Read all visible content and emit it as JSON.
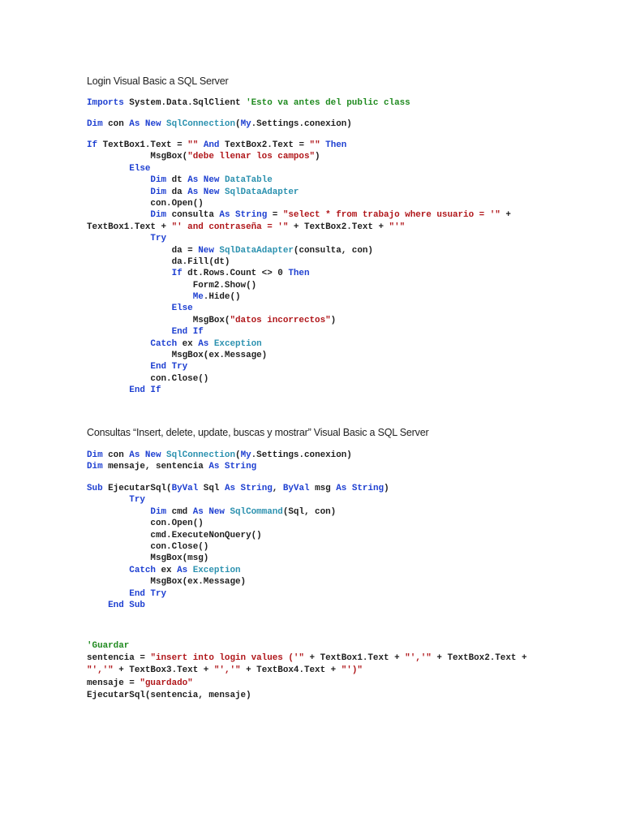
{
  "colors": {
    "keyword": "#1d3fd1",
    "type": "#2b91af",
    "string": "#b0161a",
    "comment": "#1f8a1f",
    "text": "#1e1e1e"
  },
  "title1": "Login Visual Basic a SQL Server",
  "title2": "Consultas “Insert, delete, update, buscas y mostrar” Visual Basic a SQL Server",
  "blocks": {
    "b1": [
      [
        [
          "k",
          "Imports"
        ],
        [
          "p",
          " System.Data.SqlClient "
        ],
        [
          "c",
          "'Esto va antes del public class"
        ]
      ]
    ],
    "b2": [
      [
        [
          "k",
          "Dim"
        ],
        [
          "p",
          " con "
        ],
        [
          "k",
          "As New "
        ],
        [
          "t",
          "SqlConnection"
        ],
        [
          "p",
          "("
        ],
        [
          "k",
          "My"
        ],
        [
          "p",
          ".Settings.conexion)"
        ]
      ]
    ],
    "b3": [
      [
        [
          "k",
          "If"
        ],
        [
          "p",
          " TextBox1.Text = "
        ],
        [
          "s",
          "\"\""
        ],
        [
          "p",
          " "
        ],
        [
          "k",
          "And"
        ],
        [
          "p",
          " TextBox2.Text = "
        ],
        [
          "s",
          "\"\""
        ],
        [
          "p",
          " "
        ],
        [
          "k",
          "Then"
        ]
      ],
      [
        [
          "p",
          "            MsgBox("
        ],
        [
          "s",
          "\"debe llenar los campos\""
        ],
        [
          "p",
          ")"
        ]
      ],
      [
        [
          "k",
          "        Else"
        ]
      ],
      [
        [
          "k",
          "            Dim"
        ],
        [
          "p",
          " dt "
        ],
        [
          "k",
          "As New "
        ],
        [
          "t",
          "DataTable"
        ]
      ],
      [
        [
          "k",
          "            Dim"
        ],
        [
          "p",
          " da "
        ],
        [
          "k",
          "As New "
        ],
        [
          "t",
          "SqlDataAdapter"
        ]
      ],
      [
        [
          "p",
          "            con.Open()"
        ]
      ],
      [
        [
          "k",
          "            Dim"
        ],
        [
          "p",
          " consulta "
        ],
        [
          "k",
          "As String"
        ],
        [
          "p",
          " = "
        ],
        [
          "s",
          "\"select * from trabajo where usuario = '\""
        ],
        [
          "p",
          " +"
        ]
      ],
      [
        [
          "p",
          "TextBox1.Text + "
        ],
        [
          "s",
          "\"' and contraseña = '\""
        ],
        [
          "p",
          " + TextBox2.Text + "
        ],
        [
          "s",
          "\"'\""
        ]
      ],
      [
        [
          "k",
          "            Try"
        ]
      ],
      [
        [
          "p",
          "                da = "
        ],
        [
          "k",
          "New "
        ],
        [
          "t",
          "SqlDataAdapter"
        ],
        [
          "p",
          "(consulta, con)"
        ]
      ],
      [
        [
          "p",
          "                da.Fill(dt)"
        ]
      ],
      [
        [
          "k",
          "                If"
        ],
        [
          "p",
          " dt.Rows.Count <> 0 "
        ],
        [
          "k",
          "Then"
        ]
      ],
      [
        [
          "p",
          "                    Form2.Show()"
        ]
      ],
      [
        [
          "k",
          "                    Me"
        ],
        [
          "p",
          ".Hide()"
        ]
      ],
      [
        [
          "k",
          "                Else"
        ]
      ],
      [
        [
          "p",
          "                    MsgBox("
        ],
        [
          "s",
          "\"datos incorrectos\""
        ],
        [
          "p",
          ")"
        ]
      ],
      [
        [
          "k",
          "                End If"
        ]
      ],
      [
        [
          "k",
          "            Catch"
        ],
        [
          "p",
          " ex "
        ],
        [
          "k",
          "As "
        ],
        [
          "t",
          "Exception"
        ]
      ],
      [
        [
          "p",
          "                MsgBox(ex.Message)"
        ]
      ],
      [
        [
          "k",
          "            End Try"
        ]
      ],
      [
        [
          "p",
          "            con.Close()"
        ]
      ],
      [
        [
          "k",
          "        End If"
        ]
      ]
    ],
    "b4": [
      [
        [
          "k",
          "Dim"
        ],
        [
          "p",
          " con "
        ],
        [
          "k",
          "As New "
        ],
        [
          "t",
          "SqlConnection"
        ],
        [
          "p",
          "("
        ],
        [
          "k",
          "My"
        ],
        [
          "p",
          ".Settings.conexion)"
        ]
      ],
      [
        [
          "k",
          "Dim"
        ],
        [
          "p",
          " mensaje, sentencia "
        ],
        [
          "k",
          "As String"
        ]
      ]
    ],
    "b5": [
      [
        [
          "k",
          "Sub"
        ],
        [
          "p",
          " EjecutarSql("
        ],
        [
          "k",
          "ByVal"
        ],
        [
          "p",
          " Sql "
        ],
        [
          "k",
          "As String"
        ],
        [
          "p",
          ", "
        ],
        [
          "k",
          "ByVal"
        ],
        [
          "p",
          " msg "
        ],
        [
          "k",
          "As String"
        ],
        [
          "p",
          ")"
        ]
      ],
      [
        [
          "k",
          "        Try"
        ]
      ],
      [
        [
          "k",
          "            Dim"
        ],
        [
          "p",
          " cmd "
        ],
        [
          "k",
          "As New "
        ],
        [
          "t",
          "SqlCommand"
        ],
        [
          "p",
          "(Sql, con)"
        ]
      ],
      [
        [
          "p",
          "            con.Open()"
        ]
      ],
      [
        [
          "p",
          "            cmd.ExecuteNonQuery()"
        ]
      ],
      [
        [
          "p",
          "            con.Close()"
        ]
      ],
      [
        [
          "p",
          "            MsgBox(msg)"
        ]
      ],
      [
        [
          "k",
          "        Catch"
        ],
        [
          "p",
          " ex "
        ],
        [
          "k",
          "As "
        ],
        [
          "t",
          "Exception"
        ]
      ],
      [
        [
          "p",
          "            MsgBox(ex.Message)"
        ]
      ],
      [
        [
          "k",
          "        End Try"
        ]
      ],
      [
        [
          "k",
          "    End Sub"
        ]
      ]
    ],
    "b6": [
      [
        [
          "c",
          "'Guardar"
        ]
      ],
      [
        [
          "p",
          "sentencia = "
        ],
        [
          "s",
          "\"insert into login values ('\""
        ],
        [
          "p",
          " + TextBox1.Text + "
        ],
        [
          "s",
          "\"','\""
        ],
        [
          "p",
          " + TextBox2.Text +"
        ]
      ],
      [
        [
          "s",
          "\"','\""
        ],
        [
          "p",
          " + TextBox3.Text + "
        ],
        [
          "s",
          "\"','\""
        ],
        [
          "p",
          " + TextBox4.Text + "
        ],
        [
          "s",
          "\"')\""
        ]
      ],
      [
        [
          "p",
          "mensaje = "
        ],
        [
          "s",
          "\"guardado\""
        ]
      ],
      [
        [
          "p",
          "EjecutarSql(sentencia, mensaje)"
        ]
      ]
    ]
  }
}
